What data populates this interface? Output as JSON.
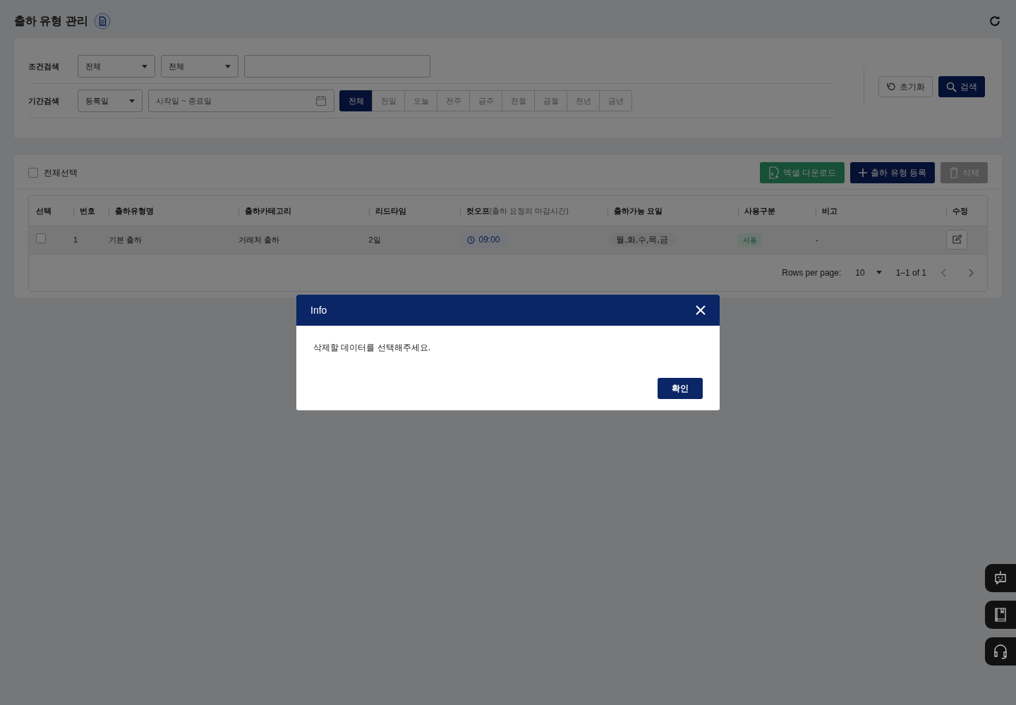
{
  "page": {
    "title": "출하 유형 관리"
  },
  "condition_search": {
    "label": "조건검색",
    "selects": [
      "전체",
      "전체"
    ]
  },
  "period_search": {
    "label": "기간검색",
    "select": "등록일",
    "date_range": {
      "placeholder": "시작일 ~ 종료일"
    },
    "periods": [
      {
        "label": "전체",
        "selected": true
      },
      {
        "label": "전일",
        "selected": false
      },
      {
        "label": "오늘",
        "selected": false
      },
      {
        "label": "전주",
        "selected": false
      },
      {
        "label": "금주",
        "selected": false
      },
      {
        "label": "전월",
        "selected": false
      },
      {
        "label": "금월",
        "selected": false
      },
      {
        "label": "전년",
        "selected": false
      },
      {
        "label": "금년",
        "selected": false
      }
    ]
  },
  "search_actions": [
    {
      "label": "초기화",
      "kind": "reset"
    },
    {
      "label": "검색",
      "kind": "search"
    }
  ],
  "list": {
    "select_all": {
      "label": "전체선택",
      "checked": false
    },
    "buttons": [
      {
        "label": "엑셀 다운로드",
        "kind": "excel",
        "disabled": false
      },
      {
        "label": "출하 유형 등록",
        "kind": "add",
        "disabled": false
      },
      {
        "label": "삭제",
        "kind": "delete",
        "disabled": true
      }
    ],
    "table": {
      "columns": [
        {
          "label": "선택"
        },
        {
          "label": "번호"
        },
        {
          "label": "출하유형명"
        },
        {
          "label": "출하카테고리"
        },
        {
          "label": "리드타임"
        },
        {
          "label": "컷오프",
          "note": "(출하 요청의 마감시간)"
        },
        {
          "label": "출하가능 요일"
        },
        {
          "label": "사용구분"
        },
        {
          "label": "비고"
        },
        {
          "label": "수정"
        }
      ],
      "rows": [
        {
          "checked": false,
          "number": "1",
          "name": "기본 출하",
          "category": "거래처 출하",
          "lead_time": "2일",
          "cutoff": "09:00",
          "days": "월,화,수,목,금",
          "usage": "사용",
          "note": "-"
        }
      ]
    },
    "pagination": {
      "rows_per_page_label": "Rows per page:",
      "rows_per_page": "10",
      "range": "1–1 of 1"
    }
  },
  "dialog": {
    "title": "Info",
    "message": "삭제할 데이터를 선택해주세요.",
    "confirm": "확인"
  }
}
